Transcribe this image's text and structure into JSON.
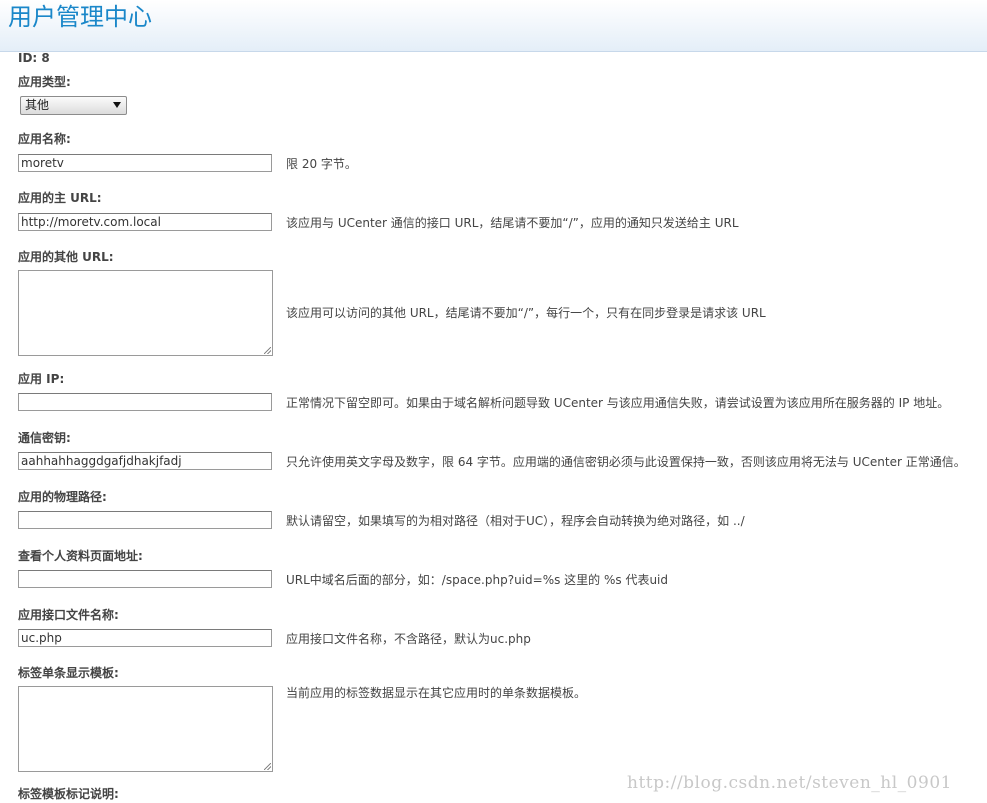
{
  "header": {
    "title": "用户管理中心"
  },
  "app_id": "ID: 8",
  "app_type": {
    "label": "应用类型:",
    "selected": "其他"
  },
  "fields": {
    "name": {
      "label": "应用名称:",
      "value": "moretv",
      "desc": "限 20 字节。"
    },
    "main_url": {
      "label": "应用的主 URL:",
      "value": "http://moretv.com.local",
      "desc": "该应用与 UCenter 通信的接口 URL，结尾请不要加“/”，应用的通知只发送给主 URL"
    },
    "other_url": {
      "label": "应用的其他 URL:",
      "value": "",
      "desc": "该应用可以访问的其他 URL，结尾请不要加“/”，每行一个，只有在同步登录是请求该 URL"
    },
    "ip": {
      "label": "应用 IP:",
      "value": "",
      "desc": "正常情况下留空即可。如果由于域名解析问题导致 UCenter 与该应用通信失败，请尝试设置为该应用所在服务器的 IP 地址。"
    },
    "key": {
      "label": "通信密钥:",
      "value": "aahhahhaggdgafjdhakjfadj",
      "desc": "只允许使用英文字母及数字，限 64 字节。应用端的通信密钥必须与此设置保持一致，否则该应用将无法与 UCenter 正常通信。"
    },
    "path": {
      "label": "应用的物理路径:",
      "value": "",
      "desc": "默认请留空，如果填写的为相对路径（相对于UC），程序会自动转换为绝对路径，如 ../"
    },
    "profile_url": {
      "label": "查看个人资料页面地址:",
      "value": "",
      "desc": "URL中域名后面的部分，如：/space.php?uid=%s 这里的 %s 代表uid"
    },
    "api_file": {
      "label": "应用接口文件名称:",
      "value": "uc.php",
      "desc": "应用接口文件名称，不含路径，默认为uc.php"
    },
    "tag_template": {
      "label": "标签单条显示模板:",
      "value": "",
      "desc": "当前应用的标签数据显示在其它应用时的单条数据模板。"
    },
    "tag_note": {
      "label": "标签模板标记说明:"
    }
  },
  "watermark": "http://blog.csdn.net/steven_hl_0901"
}
